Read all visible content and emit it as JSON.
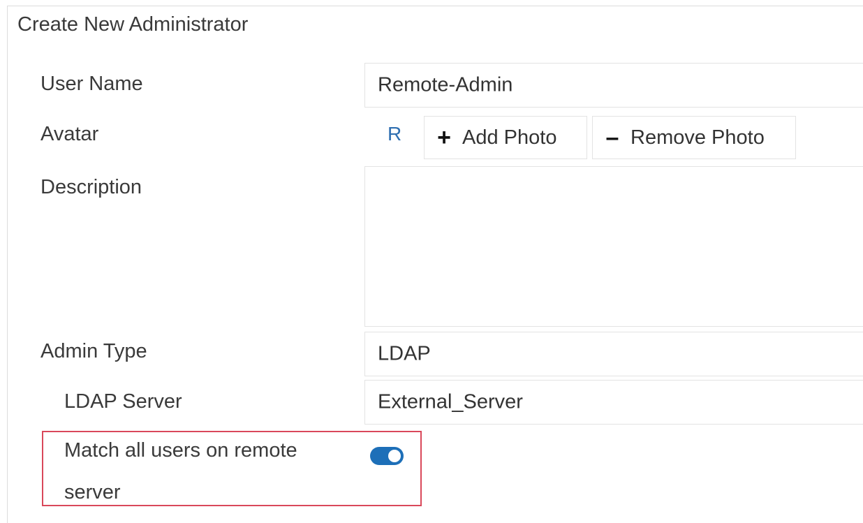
{
  "panel": {
    "title": "Create New Administrator"
  },
  "form": {
    "user_name": {
      "label": "User Name",
      "value": "Remote-Admin"
    },
    "avatar": {
      "label": "Avatar",
      "initial": "R",
      "add_icon": "plus-icon",
      "add_label": "Add Photo",
      "remove_icon": "minus-icon",
      "remove_label": "Remove Photo"
    },
    "description": {
      "label": "Description",
      "value": ""
    },
    "admin_type": {
      "label": "Admin Type",
      "value": "LDAP"
    },
    "ldap_server": {
      "label": "LDAP Server",
      "value": "External_Server"
    },
    "match_all": {
      "label_line1": "Match all users on remote",
      "label_line2": "server",
      "enabled": true
    }
  },
  "colors": {
    "toggle_on": "#1d6fb8",
    "avatar_letter": "#2f6fb1",
    "highlight_border": "#d9485a"
  }
}
